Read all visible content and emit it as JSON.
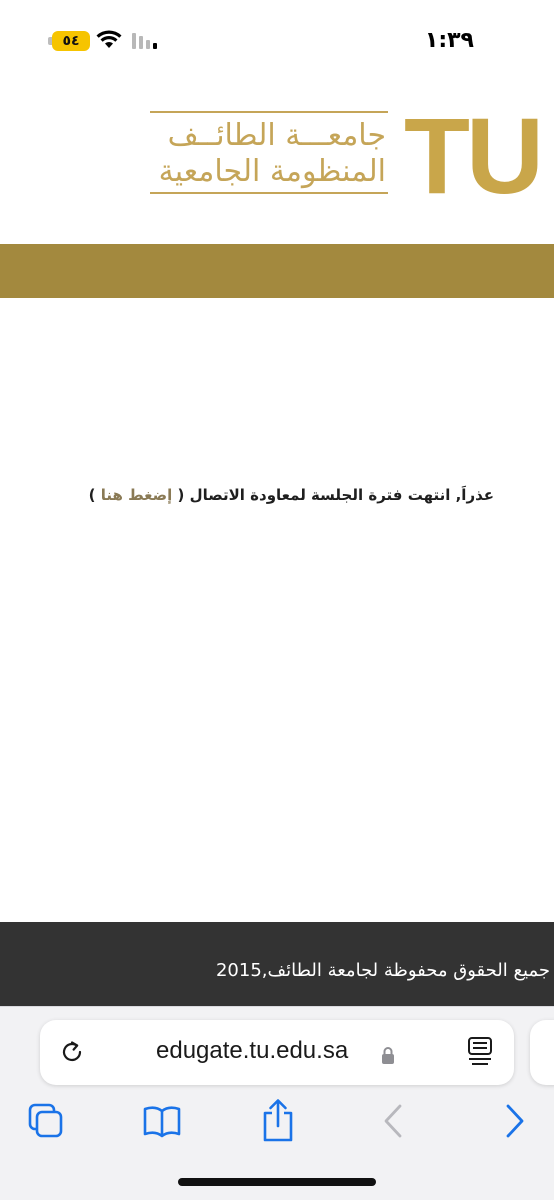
{
  "status_bar": {
    "time": "١:٣٩",
    "battery": "٥٤",
    "wifi_icon": "wifi-icon",
    "signal_icon": "cellular-signal-icon"
  },
  "header": {
    "logo_arabic_line1": "جامعـــة الطائــف",
    "logo_arabic_line2": "المنظومة الجامعية",
    "logo_mark": "TU",
    "brand_color": "#c9a64a",
    "band_color": "#a3893e"
  },
  "message": {
    "text": "عذراَ, انتهت فترة الجلسة لمعاودة الاتصال (",
    "link_label": "إضغط هنا",
    "closing": ")"
  },
  "footer": {
    "copyright": "جميع الحقوق محفوظة لجامعة الطائف,2015",
    "background": "#333333"
  },
  "browser": {
    "url": "edugate.tu.edu.sa",
    "accent": "#1a73e8",
    "icons": {
      "reload": "reload-icon",
      "lock": "lock-icon",
      "reader": "reader-mode-icon",
      "tabs": "tabs-icon",
      "bookmarks": "bookmarks-icon",
      "share": "share-icon",
      "back": "back-arrow-icon",
      "forward": "forward-arrow-icon"
    }
  }
}
